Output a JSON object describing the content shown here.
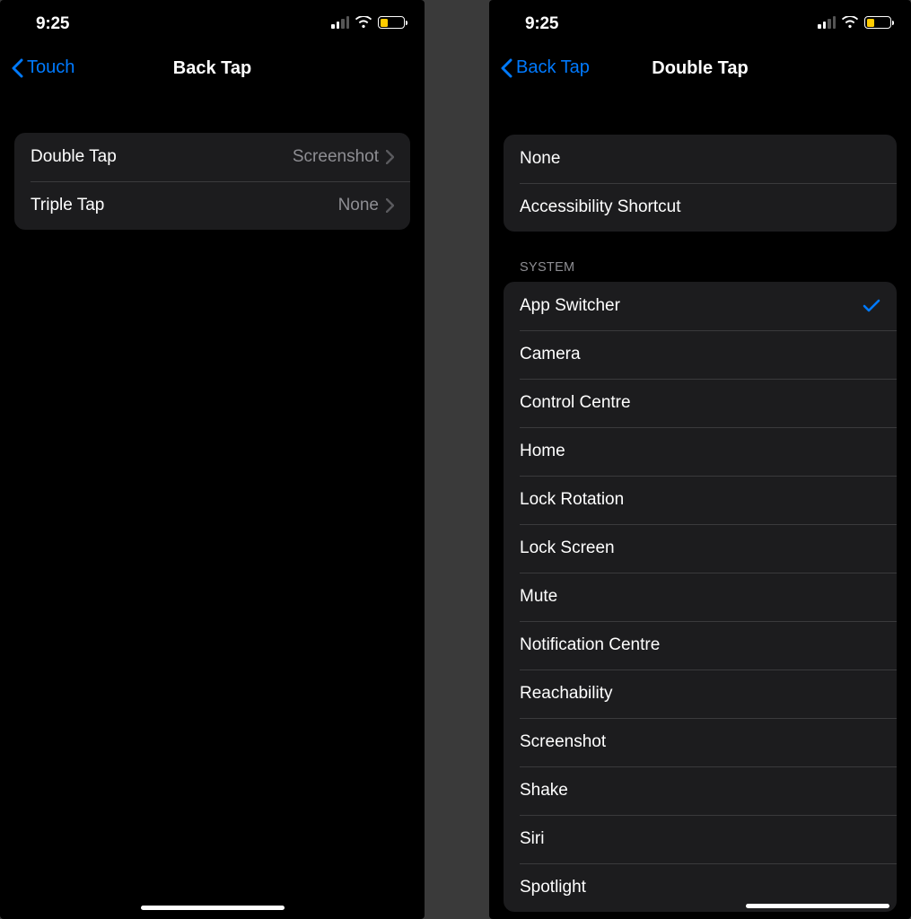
{
  "statusbar": {
    "time": "9:25"
  },
  "left": {
    "back_label": "Touch",
    "title": "Back Tap",
    "rows": [
      {
        "label": "Double Tap",
        "value": "Screenshot"
      },
      {
        "label": "Triple Tap",
        "value": "None"
      }
    ]
  },
  "right": {
    "back_label": "Back Tap",
    "title": "Double Tap",
    "topRows": [
      {
        "label": "None"
      },
      {
        "label": "Accessibility Shortcut"
      }
    ],
    "section_header": "SYSTEM",
    "systemRows": [
      {
        "label": "App Switcher",
        "selected": true
      },
      {
        "label": "Camera"
      },
      {
        "label": "Control Centre"
      },
      {
        "label": "Home"
      },
      {
        "label": "Lock Rotation"
      },
      {
        "label": "Lock Screen"
      },
      {
        "label": "Mute"
      },
      {
        "label": "Notification Centre"
      },
      {
        "label": "Reachability"
      },
      {
        "label": "Screenshot"
      },
      {
        "label": "Shake"
      },
      {
        "label": "Siri"
      },
      {
        "label": "Spotlight"
      }
    ]
  }
}
